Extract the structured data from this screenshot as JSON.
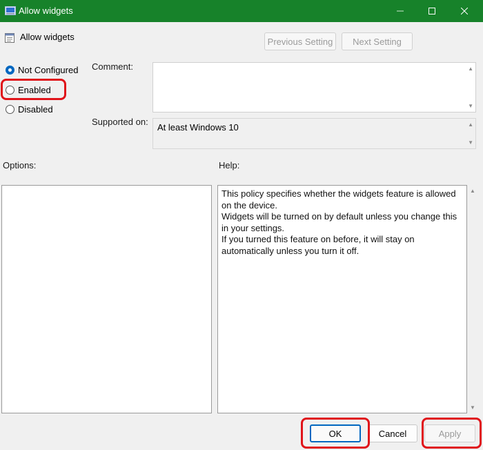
{
  "window": {
    "title": "Allow widgets",
    "controls": {
      "minimize": "minimize-icon",
      "maximize": "maximize-icon",
      "close": "close-icon"
    }
  },
  "header": {
    "title": "Allow widgets"
  },
  "navigation": {
    "previous_label": "Previous Setting",
    "next_label": "Next Setting"
  },
  "state": {
    "options": [
      {
        "label": "Not Configured",
        "checked": true
      },
      {
        "label": "Enabled",
        "checked": false
      },
      {
        "label": "Disabled",
        "checked": false
      }
    ]
  },
  "comment": {
    "label": "Comment:",
    "value": ""
  },
  "supported": {
    "label": "Supported on:",
    "value": "At least Windows 10"
  },
  "options_panel": {
    "label": "Options:"
  },
  "help_panel": {
    "label": "Help:",
    "paragraphs": [
      "This policy specifies whether the widgets feature is allowed on the device.",
      "Widgets will be turned on by default unless you change this in your settings.",
      "If you turned this feature on before, it will stay on automatically unless you turn it off."
    ]
  },
  "footer": {
    "ok_label": "OK",
    "cancel_label": "Cancel",
    "apply_label": "Apply"
  },
  "colors": {
    "titlebar": "#17822a",
    "accent": "#0067c0",
    "highlight": "#e0141a"
  }
}
